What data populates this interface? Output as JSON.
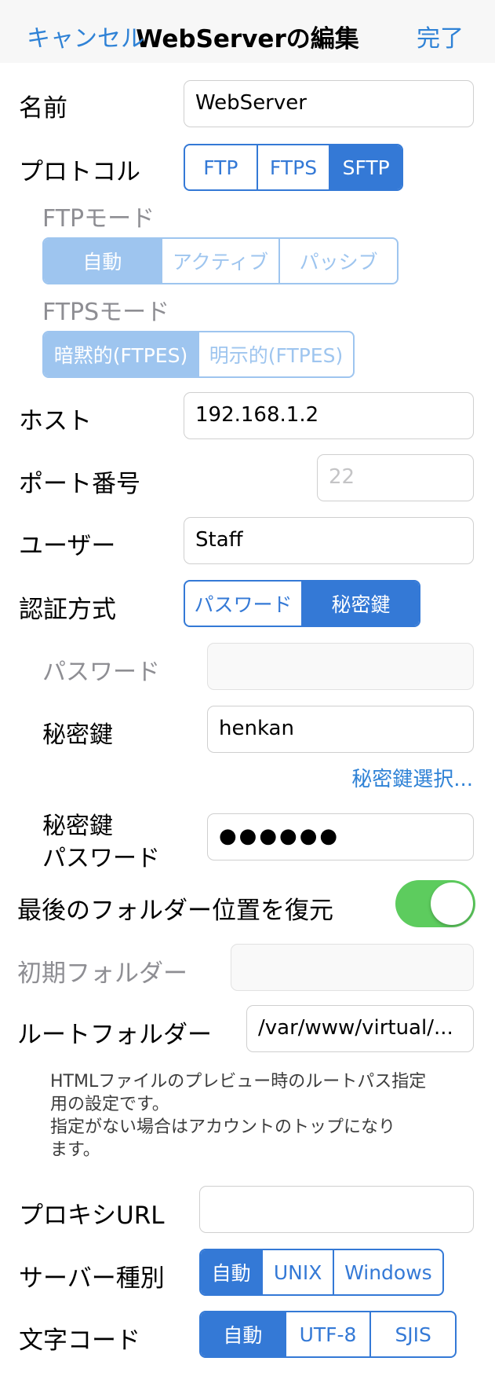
{
  "nav": {
    "cancel": "キャンセル",
    "title": "WebServerの編集",
    "done": "完了"
  },
  "name": {
    "label": "名前",
    "value": "WebServer"
  },
  "protocol": {
    "label": "プロトコル",
    "options": [
      "FTP",
      "FTPS",
      "SFTP"
    ],
    "selected": "SFTP"
  },
  "ftp_mode": {
    "label": "FTPモード",
    "options": [
      "自動",
      "アクティブ",
      "パッシブ"
    ],
    "selected": "自動"
  },
  "ftps_mode": {
    "label": "FTPSモード",
    "options": [
      "暗黙的(FTPES)",
      "明示的(FTPES)"
    ],
    "selected": "暗黙的(FTPES)"
  },
  "host": {
    "label": "ホスト",
    "value": "192.168.1.2"
  },
  "port": {
    "label": "ポート番号",
    "placeholder": "22"
  },
  "user": {
    "label": "ユーザー",
    "value": "Staff"
  },
  "auth": {
    "label": "認証方式",
    "options": [
      "パスワード",
      "秘密鍵"
    ],
    "selected": "秘密鍵"
  },
  "password": {
    "label": "パスワード",
    "value": ""
  },
  "private_key": {
    "label": "秘密鍵",
    "value": "henkan",
    "select_link": "秘密鍵選択..."
  },
  "key_password": {
    "label_line1": "秘密鍵",
    "label_line2": "パスワード",
    "value": "●●●●●●"
  },
  "restore_folder": {
    "label": "最後のフォルダー位置を復元",
    "on": true
  },
  "initial_folder": {
    "label": "初期フォルダー",
    "value": ""
  },
  "root_folder": {
    "label": "ルートフォルダー",
    "value": "/var/www/virtual/...",
    "note_lines": [
      "HTMLファイルのプレビュー時のルートパス指定",
      "用の設定です。",
      "指定がない場合はアカウントのトップになり",
      "ます。"
    ]
  },
  "proxy": {
    "label": "プロキシURL",
    "value": ""
  },
  "server_type": {
    "label": "サーバー種別",
    "options": [
      "自動",
      "UNIX",
      "Windows"
    ],
    "selected": "自動"
  },
  "charset": {
    "label": "文字コード",
    "options": [
      "自動",
      "UTF-8",
      "SJIS"
    ],
    "selected": "自動"
  },
  "colors": {
    "accent": "#3479d6",
    "toggle_on": "#5dcc5e",
    "link": "#2f82d6"
  }
}
